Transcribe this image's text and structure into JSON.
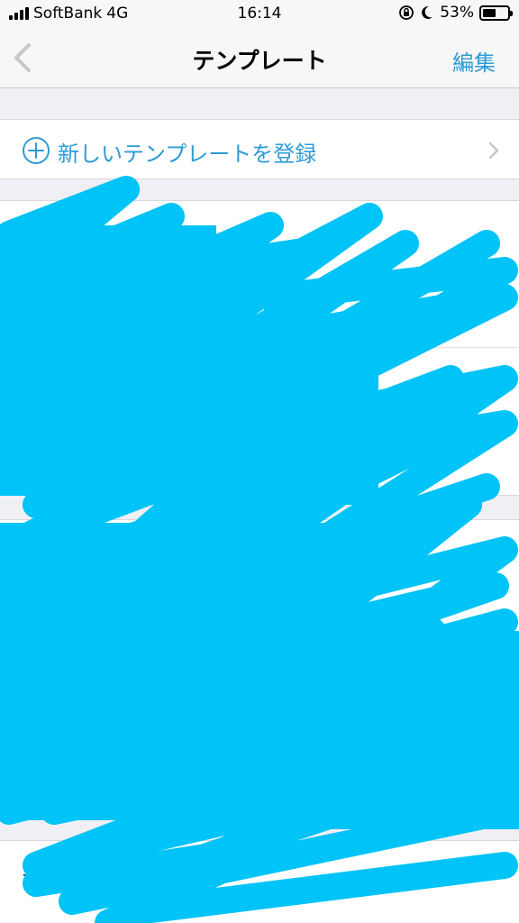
{
  "status": {
    "carrier": "SoftBank",
    "network": "4G",
    "time": "16:14",
    "battery_percent": "53%",
    "battery_level": 0.53
  },
  "nav": {
    "title": "テンプレート",
    "edit_label": "編集",
    "back_icon": "chevron-left-icon"
  },
  "new_template": {
    "label": "新しいテンプレートを登録",
    "icon": "plus-circle-icon"
  },
  "list": {
    "partial_label": "テンプレート"
  },
  "colors": {
    "accent": "#2d9bd6",
    "scribble": "#00c3f7"
  }
}
